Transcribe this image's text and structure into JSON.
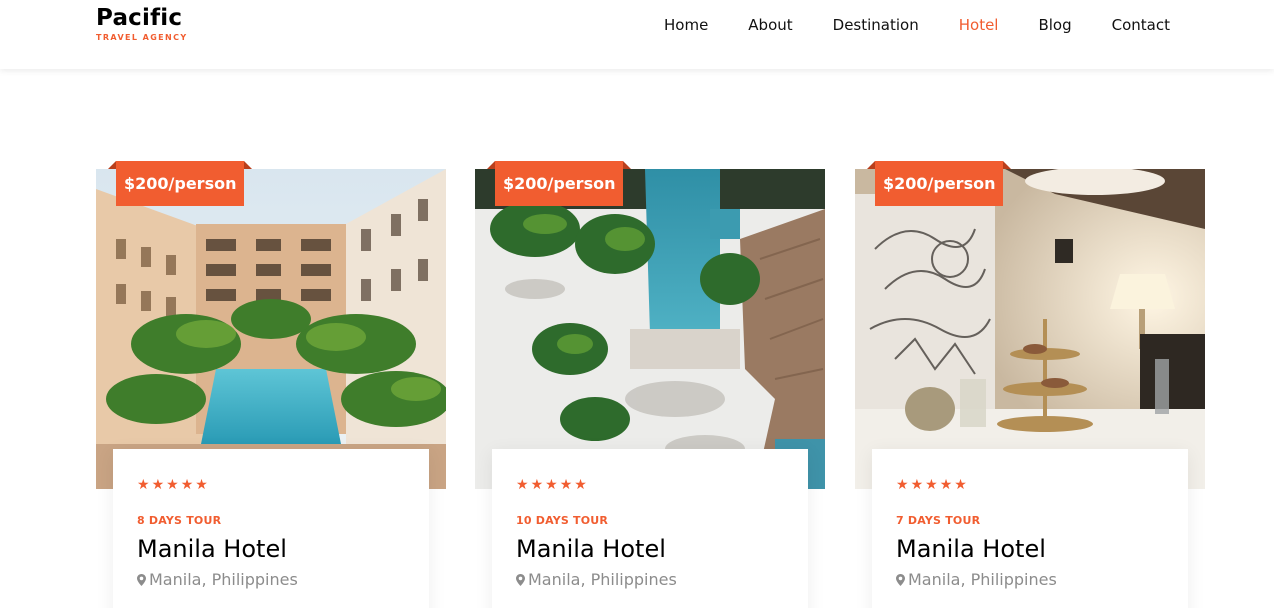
{
  "brand": {
    "name": "Pacific",
    "tagline": "TRAVEL AGENCY"
  },
  "nav": [
    {
      "label": "Home",
      "active": false
    },
    {
      "label": "About",
      "active": false
    },
    {
      "label": "Destination",
      "active": false
    },
    {
      "label": "Hotel",
      "active": true
    },
    {
      "label": "Blog",
      "active": false
    },
    {
      "label": "Contact",
      "active": false
    }
  ],
  "colors": {
    "accent": "#f15d30",
    "text": "#000000",
    "muted": "#8c8c8c"
  },
  "hotels": [
    {
      "price": "$200/person",
      "rating": 5,
      "duration": "8 DAYS TOUR",
      "name": "Manila Hotel",
      "location": "Manila, Philippines",
      "image": "hotel-courtyard-pool-photo"
    },
    {
      "price": "$200/person",
      "rating": 5,
      "duration": "10 DAYS TOUR",
      "name": "Manila Hotel",
      "location": "Manila, Philippines",
      "image": "aerial-resort-pool-palms-photo"
    },
    {
      "price": "$200/person",
      "rating": 5,
      "duration": "7 DAYS TOUR",
      "name": "Manila Hotel",
      "location": "Manila, Philippines",
      "image": "hotel-lounge-interior-photo"
    }
  ]
}
